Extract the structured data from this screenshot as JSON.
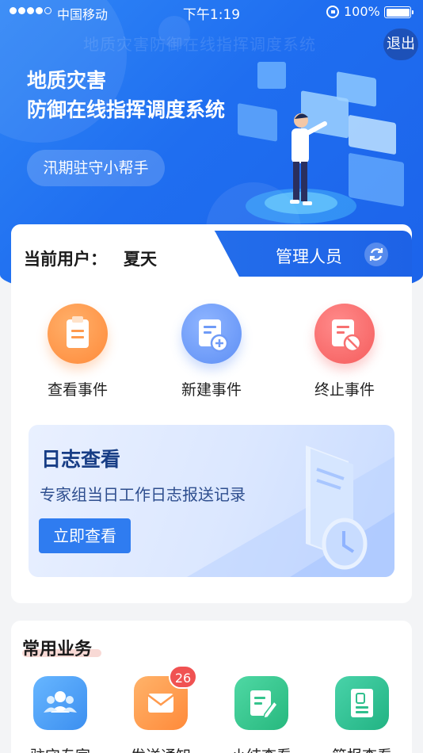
{
  "status_bar": {
    "carrier": "中国移动",
    "time": "下午1:19",
    "battery": "100%"
  },
  "header": {
    "watermark": "地质灾害防御在线指挥调度系统",
    "logout_label": "退出",
    "title_line1": "地质灾害",
    "title_line2": "防御在线指挥调度系统",
    "helper_label": "汛期驻守小帮手"
  },
  "user_card": {
    "current_user_label": "当前用户：",
    "user_name": "夏天",
    "role": "管理人员"
  },
  "actions": [
    {
      "label": "查看事件",
      "icon": "clipboard-icon",
      "color": "#ff8a3a"
    },
    {
      "label": "新建事件",
      "icon": "document-add-icon",
      "color": "#5e8ff5"
    },
    {
      "label": "终止事件",
      "icon": "document-cancel-icon",
      "color": "#f55c5c"
    }
  ],
  "log_banner": {
    "title": "日志查看",
    "subtitle": "专家组当日工作日志报送记录",
    "button_label": "立即查看"
  },
  "common_services": {
    "title": "常用业务",
    "items": [
      {
        "label": "驻守专家",
        "icon": "people-icon",
        "color": "#3c8ff0"
      },
      {
        "label": "发送通知",
        "icon": "envelope-icon",
        "color": "#ff8a3a",
        "badge": "26"
      },
      {
        "label": "小结查看",
        "icon": "edit-document-icon",
        "color": "#27b87e"
      },
      {
        "label": "简报查看",
        "icon": "report-icon",
        "color": "#22b383"
      }
    ]
  }
}
